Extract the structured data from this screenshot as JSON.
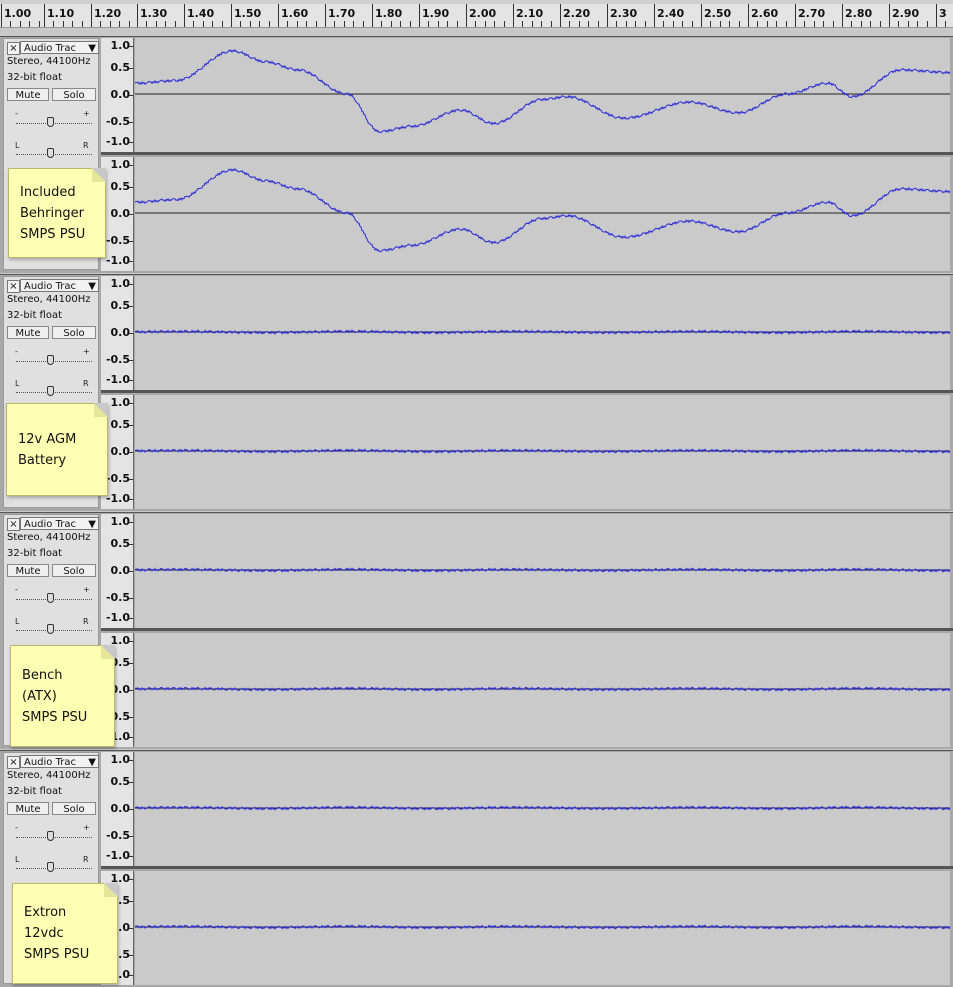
{
  "ruler": {
    "labels": [
      "1.00",
      "1.10",
      "1.20",
      "1.30",
      "1.40",
      "1.50",
      "1.60",
      "1.70",
      "1.80",
      "1.90",
      "2.00",
      "2.10",
      "2.20",
      "2.30",
      "2.40",
      "2.50",
      "2.60",
      "2.70",
      "2.80",
      "2.90",
      "3"
    ]
  },
  "axis_labels": [
    "1.0",
    "0.5",
    "0.0",
    "-0.5",
    "-1.0"
  ],
  "tracks": [
    {
      "name": "Audio Trac",
      "format": "Stereo, 44100Hz",
      "bits": "32-bit float",
      "mute": "Mute",
      "solo": "Solo",
      "gain_minus": "-",
      "gain_plus": "+",
      "pan_left": "L",
      "pan_right": "R",
      "note_lines": [
        "Included",
        "Behringer",
        "SMPS PSU"
      ]
    },
    {
      "name": "Audio Trac",
      "format": "Stereo, 44100Hz",
      "bits": "32-bit float",
      "mute": "Mute",
      "solo": "Solo",
      "gain_minus": "-",
      "gain_plus": "+",
      "pan_left": "L",
      "pan_right": "R",
      "note_lines": [
        "12v AGM",
        "Battery"
      ]
    },
    {
      "name": "Audio Trac",
      "format": "Stereo, 44100Hz",
      "bits": "32-bit float",
      "mute": "Mute",
      "solo": "Solo",
      "gain_minus": "-",
      "gain_plus": "+",
      "pan_left": "L",
      "pan_right": "R",
      "note_lines": [
        "Bench",
        "(ATX)",
        "SMPS PSU"
      ]
    },
    {
      "name": "Audio Trac",
      "format": "Stereo, 44100Hz",
      "bits": "32-bit float",
      "mute": "Mute",
      "solo": "Solo",
      "gain_minus": "-",
      "gain_plus": "+",
      "pan_left": "L",
      "pan_right": "R",
      "note_lines": [
        "Extron",
        "12vdc",
        "SMPS PSU"
      ]
    }
  ],
  "colors": {
    "waveform": "#2b2bd6",
    "note_bg": "#ffffb4"
  }
}
